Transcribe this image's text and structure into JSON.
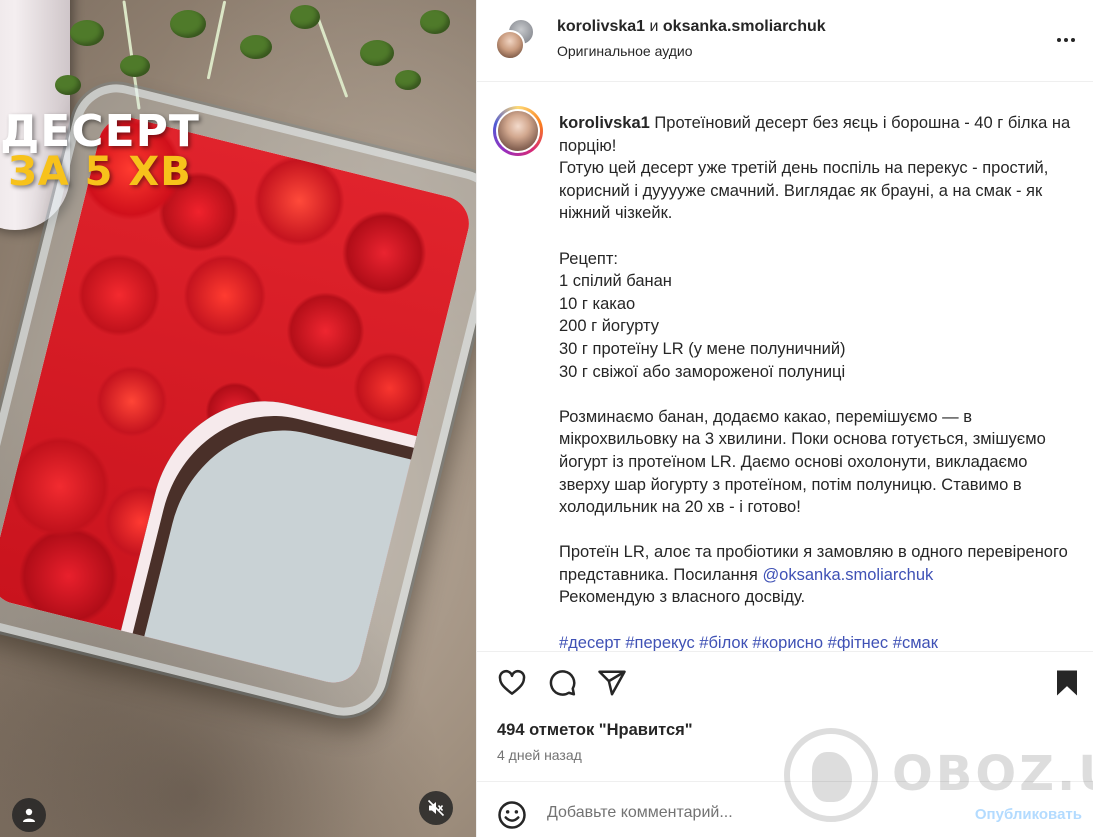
{
  "media": {
    "overlay_line1": "ДЕСЕРТ",
    "overlay_line2": "ЗА 5 ХВ",
    "overlay_color_1": "#ffffff",
    "overlay_color_2": "#f7c21b",
    "user_icon": "user-icon",
    "mute_icon": "muted-speaker-icon"
  },
  "header": {
    "user1": "korolivska1",
    "conjunction": "и",
    "user2": "oksanka.smoliarchuk",
    "audio": "Оригинальное аудио",
    "more_icon": "more-options-icon"
  },
  "caption": {
    "username": "korolivska1",
    "line_intro": "Протеїновий десерт без яєць і борошна - 40 г білка на порцію!",
    "paragraph1": "Готую цей десерт уже третій день поспіль на перекус - простий, корисний і дууууже смачний. Виглядає як брауні, а на смак - як ніжний чізкейк.",
    "recipe_title": "Рецепт:",
    "ingredients": [
      "1 спілий банан",
      "10 г какао",
      "200 г йогурту",
      "30 г протеїну LR (у мене полуничний)",
      "30 г свіжої або замороженої полуниці"
    ],
    "paragraph2": "Розминаємо банан, додаємо какао, перемішуємо — в мікрохвильовку на 3 хвилини. Поки основа готується, змішуємо йогурт із протеїном LR. Даємо основі охолонути, викладаємо зверху шар йогурту з протеїном, потім полуницю. Ставимо в холодильник на 20 хв - і готово!",
    "paragraph3_start": "Протеїн LR, алоє та пробіотики я замовляю в одного перевіреного представника. Посилання",
    "mention": "@oksanka.smoliarchuk",
    "paragraph3_end": "Рекомендую з власного досвіду.",
    "hashtags": "#десерт #перекус #білок #корисно #фітнес #смак"
  },
  "actions": {
    "like_icon": "heart-icon",
    "comment_icon": "comment-icon",
    "share_icon": "share-icon",
    "save_icon": "bookmark-icon",
    "likes_text": "494 отметок \"Нравится\"",
    "time_text": "4 дней назад"
  },
  "comment": {
    "emoji_icon": "emoji-icon",
    "placeholder": "Добавьте комментарий...",
    "publish_label": "Опубликовать"
  },
  "watermark": {
    "text": "OBOZ.UA"
  },
  "colors": {
    "link": "#3f51b5",
    "publish_disabled": "#b3dbff",
    "secondary_text": "#737373"
  }
}
